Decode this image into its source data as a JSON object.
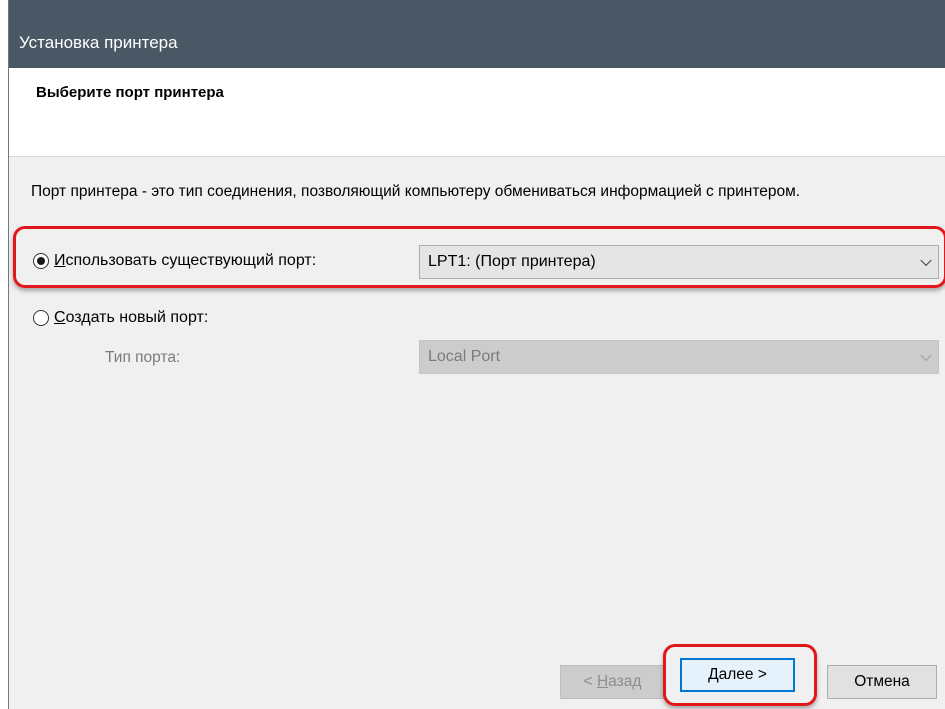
{
  "window": {
    "title": "Установка принтера"
  },
  "header": {
    "title": "Выберите порт принтера"
  },
  "description": "Порт принтера - это тип соединения, позволяющий компьютеру обмениваться информацией с принтером.",
  "use_existing": {
    "label_underlined": "И",
    "label_rest": "спользовать существующий порт:",
    "checked": true,
    "select_value": "LPT1: (Порт принтера)"
  },
  "create_new": {
    "label_underlined": "С",
    "label_rest": "оздать новый порт:",
    "checked": false,
    "type_label": "Тип порта:",
    "type_value": "Local Port"
  },
  "buttons": {
    "back_prefix": "< ",
    "back_underlined": "Н",
    "back_rest": "азад",
    "next_underlined": "Д",
    "next_rest": "алее >",
    "cancel": "Отмена"
  },
  "colors": {
    "titlebar": "#4a5764",
    "highlight": "#e0181b",
    "primary_border": "#0078d7"
  }
}
